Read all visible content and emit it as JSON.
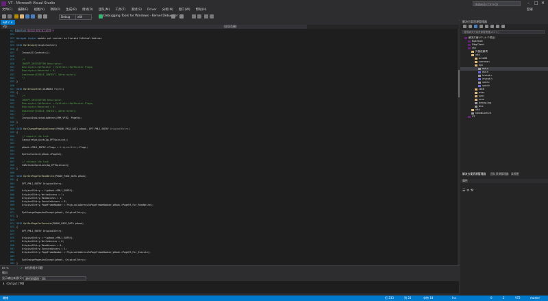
{
  "window": {
    "title": "VT - Microsoft Visual Studio",
    "quick_launch_placeholder": "快速启动 (Ctrl+Q)",
    "login": "登录"
  },
  "menu": [
    "文件(F)",
    "编辑(E)",
    "视图(V)",
    "项目(P)",
    "生成(B)",
    "调试(D)",
    "团队(M)",
    "工具(T)",
    "测试(S)",
    "Driver",
    "分析(N)",
    "窗口(W)",
    "帮助(H)"
  ],
  "toolbar": {
    "config": "Debug",
    "platform": "x64",
    "debugger": "Debugging Tools for Windows - Kernel Debugger"
  },
  "tabs": [
    {
      "label": "ept.c"
    }
  ],
  "navbar": {
    "project": "vtp",
    "scope": "(全局范围)"
  },
  "editor": {
    "lines": [
      {
        "n": "821",
        "spans": [
          {
            "t": "#define ",
            "c": "kw"
          },
          {
            "t": "BUILD_BTN_N_LAST_TP",
            "c": "macro"
          }
        ]
      },
      {
        "n": "822",
        "spans": []
      },
      {
        "n": "823",
        "spans": [
          {
            "t": "#pragma region ",
            "c": "kw"
          },
          {
            "t": "update ept context va Invvpid InEntual Address",
            "c": "id"
          }
        ]
      },
      {
        "n": "824",
        "spans": []
      },
      {
        "n": "825",
        "spans": [
          {
            "t": "VOID ",
            "c": "kw"
          },
          {
            "t": "EptInvept",
            "c": "fn"
          },
          {
            "t": "(SingleContext)",
            "c": "id"
          }
        ]
      },
      {
        "n": "826",
        "spans": [
          {
            "t": "{",
            "c": "id"
          }
        ]
      },
      {
        "n": "827",
        "spans": [
          {
            "t": "    InveptAllContexts();",
            "c": "id"
          }
        ]
      },
      {
        "n": "828",
        "spans": []
      },
      {
        "n": "829",
        "spans": [
          {
            "t": "    /*",
            "c": "comment"
          }
        ]
      },
      {
        "n": "830",
        "spans": [
          {
            "t": "    INVEPT_DESCRIPTOR Descriptor;",
            "c": "comment"
          }
        ]
      },
      {
        "n": "831",
        "spans": [
          {
            "t": "    Descriptor.EptPointer = EptState->EptPointer.Flags;",
            "c": "comment"
          }
        ]
      },
      {
        "n": "832",
        "spans": [
          {
            "t": "    Descriptor.Reserved = 0;",
            "c": "comment"
          }
        ]
      },
      {
        "n": "833",
        "spans": [
          {
            "t": "    AsmInvept(SINGLE_CONTEXT, &Descriptor);",
            "c": "comment"
          }
        ]
      },
      {
        "n": "834",
        "spans": [
          {
            "t": "    */",
            "c": "comment"
          }
        ]
      },
      {
        "n": "835",
        "spans": [
          {
            "t": "}",
            "c": "id"
          }
        ]
      },
      {
        "n": "836",
        "spans": []
      },
      {
        "n": "837",
        "spans": [
          {
            "t": "VOID ",
            "c": "kw"
          },
          {
            "t": "EptInvContext",
            "c": "fn"
          },
          {
            "t": "(ULONG64 ",
            "c": "id"
          },
          {
            "t": "PageVa",
            "c": "param"
          },
          {
            "t": ")",
            "c": "id"
          }
        ]
      },
      {
        "n": "838",
        "spans": [
          {
            "t": "{",
            "c": "id"
          }
        ]
      },
      {
        "n": "839",
        "spans": [
          {
            "t": "    /*",
            "c": "comment"
          }
        ]
      },
      {
        "n": "840",
        "spans": [
          {
            "t": "    INVEPT_DESCRIPTOR Descriptor;",
            "c": "comment"
          }
        ]
      },
      {
        "n": "841",
        "spans": [
          {
            "t": "    Descriptor.EptPointer = EptState->EptPointer.Flags;",
            "c": "comment"
          }
        ]
      },
      {
        "n": "842",
        "spans": [
          {
            "t": "    Descriptor.Reserved = 0;",
            "c": "comment"
          }
        ]
      },
      {
        "n": "843",
        "spans": [
          {
            "t": "    AsmInvept(SINGLE_CONTEXT, &Descriptor);",
            "c": "comment"
          }
        ]
      },
      {
        "n": "844",
        "spans": [
          {
            "t": "    */",
            "c": "comment"
          }
        ]
      },
      {
        "n": "845",
        "spans": [
          {
            "t": "    InvvpidIndividualAddress(VMM_VPID, PageVa);",
            "c": "id"
          }
        ]
      },
      {
        "n": "846",
        "spans": [
          {
            "t": "}",
            "c": "id"
          }
        ]
      },
      {
        "n": "847",
        "spans": []
      },
      {
        "n": "848",
        "spans": [
          {
            "t": "VOID ",
            "c": "kw"
          },
          {
            "t": "EptChangePagesAndInvept",
            "c": "fn"
          },
          {
            "t": "(PHOOK_PAGE_DATA pHook, EPT_PML1_ENTRY ",
            "c": "id"
          },
          {
            "t": "OriginalEntry",
            "c": "param"
          },
          {
            "t": ")",
            "c": "id"
          }
        ]
      },
      {
        "n": "849",
        "spans": [
          {
            "t": "{",
            "c": "id"
          }
        ]
      },
      {
        "n": "850",
        "spans": [
          {
            "t": "    // acquire the lock",
            "c": "comment"
          }
        ]
      },
      {
        "n": "851",
        "spans": [
          {
            "t": "    CacquireSpinLock(&g_EPTSpinLock);",
            "c": "id"
          }
        ]
      },
      {
        "n": "852",
        "spans": []
      },
      {
        "n": "853",
        "spans": [
          {
            "t": "    pHook->PML1_ENTRY->Flags = ",
            "c": "id"
          },
          {
            "t": "OriginalEntry",
            "c": "param"
          },
          {
            "t": ".Flags;",
            "c": "id"
          }
        ]
      },
      {
        "n": "854",
        "spans": []
      },
      {
        "n": "855",
        "spans": [
          {
            "t": "    EptInvContext(pHook->PageVA);",
            "c": "id"
          }
        ]
      },
      {
        "n": "856",
        "spans": []
      },
      {
        "n": "857",
        "spans": [
          {
            "t": "    // release the lock",
            "c": "comment"
          }
        ]
      },
      {
        "n": "858",
        "spans": [
          {
            "t": "    CmReleaseSpinLock(&g_EPTSpinLock);",
            "c": "id"
          }
        ]
      },
      {
        "n": "859",
        "spans": [
          {
            "t": "}",
            "c": "id"
          }
        ]
      },
      {
        "n": "860",
        "spans": []
      },
      {
        "n": "861",
        "spans": [
          {
            "t": "VOID ",
            "c": "kw"
          },
          {
            "t": "EptSetPageForReadWrite",
            "c": "fn"
          },
          {
            "t": "(PHOOK_PAGE_DATA pHook)",
            "c": "id"
          }
        ]
      },
      {
        "n": "862",
        "spans": [
          {
            "t": "{",
            "c": "id"
          }
        ]
      },
      {
        "n": "863",
        "spans": [
          {
            "t": "    EPT_PML1_ENTRY OriginalEntry;",
            "c": "id"
          }
        ]
      },
      {
        "n": "864",
        "spans": []
      },
      {
        "n": "865",
        "spans": [
          {
            "t": "    OriginalEntry = *(pHook->PML1_ENTRY);",
            "c": "id"
          }
        ]
      },
      {
        "n": "866",
        "spans": [
          {
            "t": "    OriginalEntry.WriteAccess = 1;",
            "c": "id"
          }
        ]
      },
      {
        "n": "867",
        "spans": [
          {
            "t": "    OriginalEntry.ReadAccess = 1;",
            "c": "id"
          }
        ]
      },
      {
        "n": "868",
        "spans": [
          {
            "t": "    OriginalEntry.ExecuteAccess = 0;",
            "c": "id"
          }
        ]
      },
      {
        "n": "869",
        "spans": [
          {
            "t": "    OriginalEntry.PageFrameNumber = PhysicalAddressToPageFrameNumber(pHook->PagePA_For_ReadWrite);",
            "c": "id"
          }
        ]
      },
      {
        "n": "870",
        "spans": []
      },
      {
        "n": "871",
        "spans": [
          {
            "t": "    EptChangePagesAndInvept(pHook, OriginalEntry);",
            "c": "id"
          }
        ]
      },
      {
        "n": "872",
        "spans": [
          {
            "t": "}",
            "c": "id"
          }
        ]
      },
      {
        "n": "873",
        "spans": []
      },
      {
        "n": "874",
        "spans": [
          {
            "t": "VOID ",
            "c": "kw"
          },
          {
            "t": "EptSetPageForExecute",
            "c": "fn"
          },
          {
            "t": "(PHOOK_PAGE_DATA pHook)",
            "c": "id"
          }
        ]
      },
      {
        "n": "875",
        "spans": [
          {
            "t": "{",
            "c": "id"
          }
        ]
      },
      {
        "n": "876",
        "spans": [
          {
            "t": "    EPT_PML1_ENTRY OriginalEntry;",
            "c": "id"
          }
        ]
      },
      {
        "n": "877",
        "spans": []
      },
      {
        "n": "878",
        "spans": [
          {
            "t": "    OriginalEntry = *(pHook->PML1_ENTRY);",
            "c": "id"
          }
        ]
      },
      {
        "n": "879",
        "spans": [
          {
            "t": "    OriginalEntry.WriteAccess = 0;",
            "c": "id"
          }
        ]
      },
      {
        "n": "880",
        "spans": [
          {
            "t": "    OriginalEntry.ReadAccess = 0;",
            "c": "id"
          }
        ]
      },
      {
        "n": "881",
        "spans": [
          {
            "t": "    OriginalEntry.ExecuteAccess = 1;",
            "c": "id"
          }
        ]
      },
      {
        "n": "882",
        "spans": [
          {
            "t": "    OriginalEntry.PageFrameNumber = PhysicalAddressToPageFrameNumber(pHook->PagePA_For_Execute);",
            "c": "id"
          }
        ]
      },
      {
        "n": "883",
        "spans": []
      },
      {
        "n": "884",
        "spans": [
          {
            "t": "    EptChangePagesAndInvept(pHook, OriginalEntry);",
            "c": "id"
          }
        ]
      },
      {
        "n": "885",
        "spans": [
          {
            "t": "}",
            "c": "id"
          }
        ]
      }
    ]
  },
  "editor_status": {
    "zoom": "85 %",
    "info": "未找到相关问题"
  },
  "output": {
    "title": "输出",
    "source_label": "显示输出来源(S):",
    "source_value": "源代码管理 - Git",
    "text": "$ (Output)TRD"
  },
  "statusbar": {
    "ready": "就绪",
    "line": "行 233",
    "col": "列 22",
    "ch": "字符 18",
    "ins": "Ins",
    "errors": "0",
    "warnings": "2",
    "branch": "VT2",
    "repo": "master"
  },
  "solution_explorer": {
    "title": "解决方案资源管理器",
    "search_placeholder": "搜索解决方案资源管理器(Ctrl+;)",
    "items": [
      {
        "label": "解决方案'VT' (4 个项目)",
        "depth": 0,
        "icon": "solution"
      },
      {
        "label": "BpkHook",
        "depth": 1,
        "icon": "proj"
      },
      {
        "label": "DbgClient",
        "depth": 1,
        "icon": "proj"
      },
      {
        "label": "vtp",
        "depth": 1,
        "icon": "proj"
      },
      {
        "label": "外部依赖项",
        "depth": 2,
        "icon": "folder"
      },
      {
        "label": "x64",
        "depth": 2,
        "icon": "folder"
      },
      {
        "label": "amd64",
        "depth": 3,
        "icon": "folder"
      },
      {
        "label": "common",
        "depth": 3,
        "icon": "folder"
      },
      {
        "label": "ept",
        "depth": 3,
        "icon": "folder"
      },
      {
        "label": "ept.c",
        "depth": 4,
        "icon": "c"
      },
      {
        "label": "ept.h",
        "depth": 4,
        "icon": "h"
      },
      {
        "label": "invept.c",
        "depth": 4,
        "icon": "c"
      },
      {
        "label": "invept.h",
        "depth": 4,
        "icon": "h"
      },
      {
        "label": "vpid.c",
        "depth": 4,
        "icon": "c"
      },
      {
        "label": "vpid.h",
        "depth": 4,
        "icon": "h"
      },
      {
        "label": "i386",
        "depth": 3,
        "icon": "folder"
      },
      {
        "label": "misc",
        "depth": 3,
        "icon": "folder"
      },
      {
        "label": "svm",
        "depth": 3,
        "icon": "folder"
      },
      {
        "label": "vmx",
        "depth": 3,
        "icon": "folder"
      },
      {
        "label": "debug.log",
        "depth": 3,
        "icon": "c"
      },
      {
        "label": "dirs",
        "depth": 3,
        "icon": "c"
      },
      {
        "label": "x64",
        "depth": 2,
        "icon": "folder"
      },
      {
        "label": "NewBuoHLnf",
        "depth": 2,
        "icon": "c"
      },
      {
        "label": "VT",
        "depth": 1,
        "icon": "proj"
      }
    ],
    "tabs": [
      "解决方案资源管理器",
      "团队资源管理器",
      "类视图"
    ]
  },
  "properties": {
    "title": "属性"
  }
}
